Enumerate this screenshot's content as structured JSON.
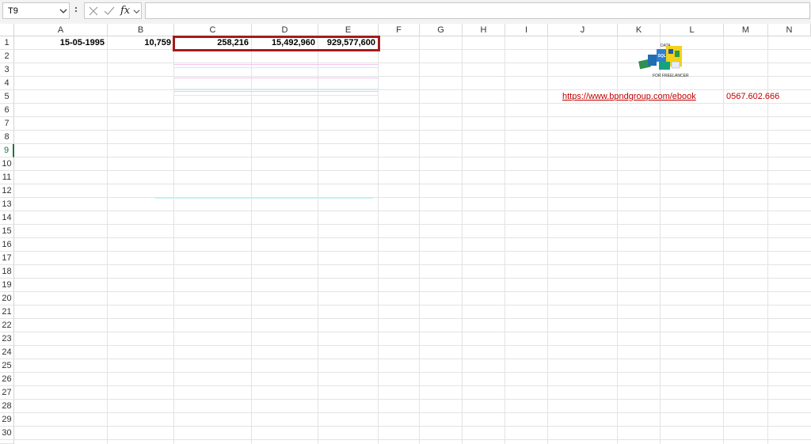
{
  "name_box": {
    "value": "T9"
  },
  "formula_bar": {
    "fx_label": "fx",
    "value": ""
  },
  "columns": [
    "A",
    "B",
    "C",
    "D",
    "E",
    "F",
    "G",
    "H",
    "I",
    "J",
    "K",
    "L",
    "M",
    "N"
  ],
  "rows": [
    "1",
    "2",
    "3",
    "4",
    "5",
    "6",
    "7",
    "8",
    "9",
    "10",
    "11",
    "12",
    "13",
    "14",
    "15",
    "16",
    "17",
    "18",
    "19",
    "20",
    "21",
    "22",
    "23",
    "24",
    "25",
    "26",
    "27",
    "28",
    "29",
    "30"
  ],
  "active_row": "9",
  "cells": {
    "A1": "15-05-1995",
    "B1": "10,759",
    "C1": "258,216",
    "D1": "15,492,960",
    "E1": "929,577,600",
    "J5": "https://www.bpndgroup.com/ebook",
    "M5": "0567.602.666"
  },
  "logo": {
    "top_text": "DATA",
    "bottom_text": "FOR FREELANCER",
    "badge_text": "SQL"
  },
  "colors": {
    "selection_border": "#a31c1c",
    "link": "#c00000",
    "active_row": "#217346"
  }
}
